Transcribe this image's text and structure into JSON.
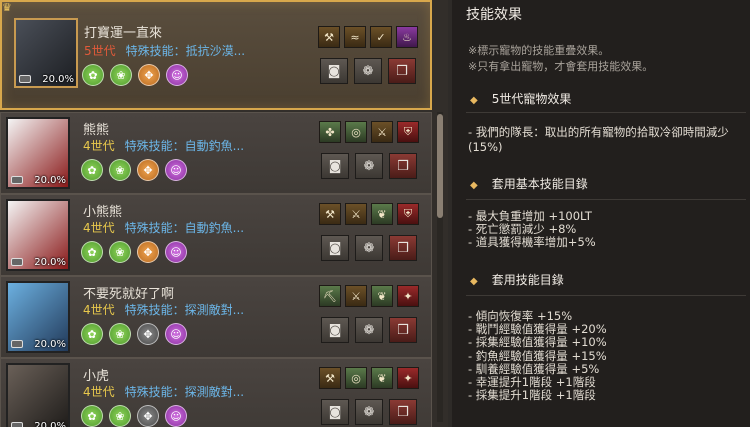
{
  "pets": [
    {
      "name": "打寶運一直來",
      "generation": "5世代",
      "skill": "特殊技能：抵抗沙漠...",
      "level": "20.0%",
      "portrait": "gray-wolf",
      "skills": [
        "mining-icon",
        "fishing-icon",
        "lure-icon",
        "potion-icon"
      ],
      "attributes": [
        "green",
        "green",
        "orange",
        "purple"
      ]
    },
    {
      "name": "熊熊",
      "generation": "4世代",
      "skill": "特殊技能：自動釣魚...",
      "level": "20.0%",
      "portrait": "santa-polar-bear",
      "skills": [
        "clover-icon",
        "rope-icon",
        "axe-icon",
        "armor-icon"
      ],
      "attributes": [
        "green",
        "green",
        "orange",
        "purple"
      ]
    },
    {
      "name": "小熊熊",
      "generation": "4世代",
      "skill": "特殊技能：自動釣魚...",
      "level": "20.0%",
      "portrait": "santa-polar-bear",
      "skills": [
        "mining-icon",
        "axe-icon",
        "wings-icon",
        "armor-icon"
      ],
      "attributes": [
        "green",
        "green",
        "orange",
        "purple"
      ]
    },
    {
      "name": "不要死就好了啊",
      "generation": "4世代",
      "skill": "特殊技能：探測敵對...",
      "level": "20.0%",
      "portrait": "blue-dragon",
      "skills": [
        "pickaxe-icon",
        "axe-icon",
        "wings-icon",
        "target-icon"
      ],
      "attributes": [
        "green",
        "green",
        "gray",
        "purple"
      ]
    },
    {
      "name": "小虎",
      "generation": "4世代",
      "skill": "特殊技能：探測敵對...",
      "level": "20.0%",
      "portrait": "tabby-cat",
      "skills": [
        "mining-icon",
        "rope-icon",
        "wings-icon",
        "target-icon"
      ],
      "attributes": [
        "green",
        "green",
        "gray",
        "purple"
      ]
    }
  ],
  "actions": [
    "feed-bowl-icon",
    "paw-icon",
    "gift-box-icon"
  ],
  "panel": {
    "title": "技能效果",
    "note1": "※標示寵物的技能重疊效果。",
    "note2": "※只有拿出寵物，才會套用技能效果。",
    "section1_title": "5世代寵物效果",
    "section1_text": "- 我們的隊長：取出的所有寵物的拾取冷卻時間減少(15%)",
    "section2_title": "套用基本技能目錄",
    "section2_items": [
      "- 最大負重增加 +100LT",
      "- 死亡懲罰減少 +8%",
      "- 道具獲得機率增加+5%"
    ],
    "section3_title": "套用技能目錄",
    "section3_items": [
      "- 傾向恢復率 +15%",
      "- 戰鬥經驗值獲得量 +20%",
      "- 採集經驗值獲得量 +10%",
      "- 釣魚經驗值獲得量 +15%",
      "- 馴養經驗值獲得量 +5%",
      "- 幸運提升1階段 +1階段",
      "- 採集提升1階段 +1階段"
    ]
  },
  "colors": {
    "accent": "#d8a84c",
    "skill_text": "#6cb6e8",
    "gen_gold": "#e8c84c",
    "gen_red": "#e05a3a"
  }
}
